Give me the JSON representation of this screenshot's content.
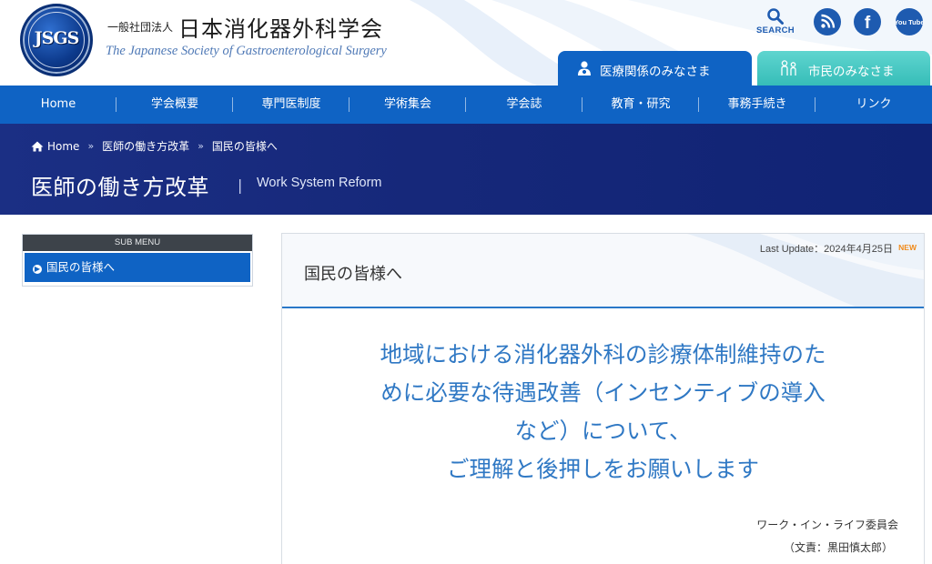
{
  "header": {
    "logo_text": "JSGS",
    "org_prefix": "一般社団法人",
    "org_name": "日本消化器外科学会",
    "org_name_en": "The Japanese Society of Gastroenterological Surgery",
    "search_label": "SEARCH",
    "social": [
      {
        "name": "rss-icon"
      },
      {
        "name": "facebook-icon",
        "glyph": "f"
      },
      {
        "name": "youtube-icon",
        "glyph": "You Tube"
      }
    ],
    "tabs": [
      {
        "label": "医療関係のみなさま"
      },
      {
        "label": "市民のみなさま"
      }
    ]
  },
  "nav": {
    "items": [
      "Home",
      "学会概要",
      "専門医制度",
      "学術集会",
      "学会誌",
      "教育・研究",
      "事務手続き",
      "リンク"
    ]
  },
  "banner": {
    "breadcrumb": [
      "Home",
      "医師の働き方改革",
      "国民の皆様へ"
    ],
    "breadcrumb_sep": "»",
    "title_jp": "医師の働き方改革",
    "title_sep": "|",
    "title_en": "Work System Reform"
  },
  "sidebar": {
    "heading": "SUB MENU",
    "items": [
      "国民の皆様へ"
    ]
  },
  "content": {
    "last_update": "Last Update：2024年4月25日",
    "new_badge": "NEW",
    "title": "国民の皆様へ",
    "message_lines": [
      "地域における消化器外科の診療体制維持のた",
      "めに必要な待遇改善（インセンティブの導入",
      "など）について、",
      "ご理解と後押しをお願いします"
    ],
    "committee": "ワーク・イン・ライフ委員会",
    "author": "（文責：黒田慎太郎）"
  },
  "colors": {
    "primary_blue": "#0f63c4",
    "banner_navy": "#16287a",
    "teal_tab": "#36bdb8",
    "message_blue": "#2f78c4",
    "new_orange": "#f08a1a"
  }
}
